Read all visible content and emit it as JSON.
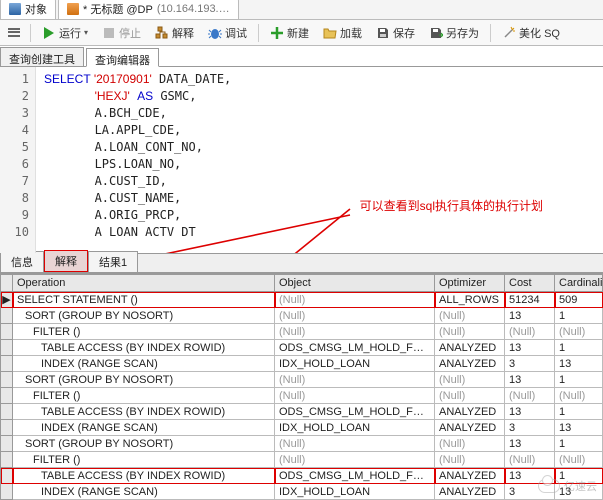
{
  "filetabs": {
    "tab1": "对象",
    "tab2_prefix": "* 无标题 @DP",
    "tab2_suffix": "(10.164.193.…"
  },
  "toolbar": {
    "run": "运行",
    "stop": "停止",
    "explain": "解释",
    "debug": "调试",
    "new": "新建",
    "load": "加载",
    "save": "保存",
    "saveas": "另存为",
    "beautify": "美化 SQ"
  },
  "subtabs": {
    "builder": "查询创建工具",
    "editor": "查询编辑器"
  },
  "code": {
    "lines": [
      {
        "n": "1",
        "seg": [
          {
            "t": "SELECT ",
            "c": "kw"
          },
          {
            "t": "'20170901'",
            "c": "str"
          },
          {
            "t": " DATA_DATE,"
          }
        ]
      },
      {
        "n": "2",
        "seg": [
          {
            "t": "       "
          },
          {
            "t": "'HEXJ'",
            "c": "str"
          },
          {
            "t": " "
          },
          {
            "t": "AS",
            "c": "kw"
          },
          {
            "t": " GSMC,"
          }
        ]
      },
      {
        "n": "3",
        "seg": [
          {
            "t": "       A.BCH_CDE,"
          }
        ]
      },
      {
        "n": "4",
        "seg": [
          {
            "t": "       LA.APPL_CDE,"
          }
        ]
      },
      {
        "n": "5",
        "seg": [
          {
            "t": "       A.LOAN_CONT_NO,"
          }
        ]
      },
      {
        "n": "6",
        "seg": [
          {
            "t": "       LPS.LOAN_NO,"
          }
        ]
      },
      {
        "n": "7",
        "seg": [
          {
            "t": "       A.CUST_ID,"
          }
        ]
      },
      {
        "n": "8",
        "seg": [
          {
            "t": "       A.CUST_NAME,"
          }
        ]
      },
      {
        "n": "9",
        "seg": [
          {
            "t": "       A.ORIG_PRCP,"
          }
        ]
      },
      {
        "n": "10",
        "seg": [
          {
            "t": "       A LOAN ACTV DT"
          }
        ]
      }
    ]
  },
  "annotation": "可以查看到sql执行具体的执行计划",
  "restabs": {
    "info": "信息",
    "explain": "解释",
    "result1": "结果1"
  },
  "grid": {
    "headers": {
      "operation": "Operation",
      "object": "Object",
      "optimizer": "Optimizer",
      "cost": "Cost",
      "cardinality": "Cardinali"
    },
    "null": "(Null)",
    "rows": [
      {
        "op": "SELECT STATEMENT ()",
        "indent": 0,
        "obj": null,
        "opt": "ALL_ROWS",
        "cost": "51234",
        "card": "509",
        "hl": "red",
        "marker": "▶"
      },
      {
        "op": "SORT (GROUP BY NOSORT)",
        "indent": 1,
        "obj": null,
        "opt": null,
        "cost": "13",
        "card": "1"
      },
      {
        "op": "FILTER ()",
        "indent": 2,
        "obj": null,
        "opt": null,
        "cost": null,
        "card": null
      },
      {
        "op": "TABLE ACCESS (BY INDEX ROWID)",
        "indent": 3,
        "obj": "ODS_CMSG_LM_HOLD_FEE_TX",
        "opt": "ANALYZED",
        "cost": "13",
        "card": "1"
      },
      {
        "op": "INDEX (RANGE SCAN)",
        "indent": 3,
        "obj": "IDX_HOLD_LOAN",
        "opt": "ANALYZED",
        "cost": "3",
        "card": "13"
      },
      {
        "op": "SORT (GROUP BY NOSORT)",
        "indent": 1,
        "obj": null,
        "opt": null,
        "cost": "13",
        "card": "1"
      },
      {
        "op": "FILTER ()",
        "indent": 2,
        "obj": null,
        "opt": null,
        "cost": null,
        "card": null
      },
      {
        "op": "TABLE ACCESS (BY INDEX ROWID)",
        "indent": 3,
        "obj": "ODS_CMSG_LM_HOLD_FEE_TX",
        "opt": "ANALYZED",
        "cost": "13",
        "card": "1"
      },
      {
        "op": "INDEX (RANGE SCAN)",
        "indent": 3,
        "obj": "IDX_HOLD_LOAN",
        "opt": "ANALYZED",
        "cost": "3",
        "card": "13"
      },
      {
        "op": "SORT (GROUP BY NOSORT)",
        "indent": 1,
        "obj": null,
        "opt": null,
        "cost": "13",
        "card": "1"
      },
      {
        "op": "FILTER ()",
        "indent": 2,
        "obj": null,
        "opt": null,
        "cost": null,
        "card": null
      },
      {
        "op": "TABLE ACCESS (BY INDEX ROWID)",
        "indent": 3,
        "obj": "ODS_CMSG_LM_HOLD_FEE_TX",
        "opt": "ANALYZED",
        "cost": "13",
        "card": "1",
        "hl": "red"
      },
      {
        "op": "INDEX (RANGE SCAN)",
        "indent": 3,
        "obj": "IDX_HOLD_LOAN",
        "opt": "ANALYZED",
        "cost": "3",
        "card": "13"
      }
    ]
  },
  "watermark": "亿速云"
}
